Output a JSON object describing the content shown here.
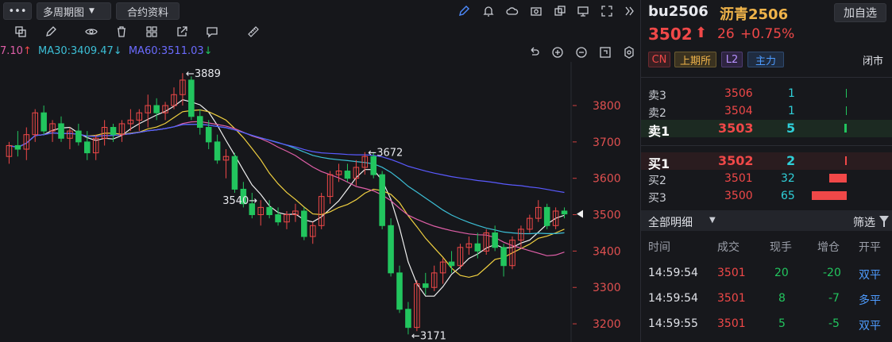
{
  "toolbar": {
    "menu_label": "•••",
    "period_label": "多周期图",
    "contract_label": "合约资料"
  },
  "legend": {
    "ma_partial": "7.10",
    "ma30": "MA30:3409.47",
    "ma60": "MA60:3511.03"
  },
  "chart_data": {
    "type": "candlestick",
    "y_ticks": [
      "3800",
      "3700",
      "3600",
      "3500",
      "3400",
      "3300",
      "3200"
    ],
    "ylim": [
      3150,
      3920
    ],
    "current_price": "3502",
    "annotations": [
      {
        "label": "←3889",
        "value": 3889
      },
      {
        "label": "←3672",
        "value": 3672
      },
      {
        "label": "3540→",
        "value": 3540
      },
      {
        "label": "←3171",
        "value": 3171
      }
    ],
    "candles": [
      [
        3660,
        3700,
        3640,
        3690
      ],
      [
        3690,
        3730,
        3660,
        3680
      ],
      [
        3680,
        3740,
        3650,
        3720
      ],
      [
        3720,
        3790,
        3700,
        3780
      ],
      [
        3780,
        3800,
        3720,
        3730
      ],
      [
        3730,
        3760,
        3700,
        3750
      ],
      [
        3750,
        3770,
        3700,
        3710
      ],
      [
        3710,
        3740,
        3680,
        3730
      ],
      [
        3730,
        3750,
        3690,
        3700
      ],
      [
        3700,
        3730,
        3650,
        3670
      ],
      [
        3670,
        3720,
        3650,
        3710
      ],
      [
        3710,
        3760,
        3690,
        3740
      ],
      [
        3740,
        3750,
        3700,
        3720
      ],
      [
        3720,
        3760,
        3700,
        3750
      ],
      [
        3750,
        3790,
        3730,
        3760
      ],
      [
        3760,
        3790,
        3730,
        3780
      ],
      [
        3780,
        3830,
        3740,
        3800
      ],
      [
        3800,
        3820,
        3760,
        3780
      ],
      [
        3780,
        3810,
        3760,
        3800
      ],
      [
        3800,
        3850,
        3790,
        3830
      ],
      [
        3830,
        3889,
        3800,
        3870
      ],
      [
        3870,
        3880,
        3760,
        3770
      ],
      [
        3770,
        3790,
        3720,
        3740
      ],
      [
        3740,
        3760,
        3680,
        3700
      ],
      [
        3700,
        3720,
        3640,
        3650
      ],
      [
        3650,
        3680,
        3600,
        3660
      ],
      [
        3660,
        3670,
        3560,
        3570
      ],
      [
        3570,
        3590,
        3520,
        3530
      ],
      [
        3530,
        3560,
        3490,
        3500
      ],
      [
        3500,
        3540,
        3470,
        3520
      ],
      [
        3520,
        3540,
        3490,
        3500
      ],
      [
        3500,
        3520,
        3470,
        3480
      ],
      [
        3480,
        3510,
        3460,
        3500
      ],
      [
        3500,
        3530,
        3480,
        3510
      ],
      [
        3510,
        3520,
        3430,
        3440
      ],
      [
        3440,
        3480,
        3420,
        3470
      ],
      [
        3470,
        3560,
        3460,
        3550
      ],
      [
        3550,
        3620,
        3530,
        3610
      ],
      [
        3610,
        3640,
        3590,
        3620
      ],
      [
        3620,
        3640,
        3590,
        3600
      ],
      [
        3600,
        3650,
        3580,
        3630
      ],
      [
        3630,
        3672,
        3610,
        3660
      ],
      [
        3660,
        3672,
        3600,
        3610
      ],
      [
        3610,
        3620,
        3460,
        3470
      ],
      [
        3470,
        3490,
        3330,
        3340
      ],
      [
        3340,
        3360,
        3230,
        3240
      ],
      [
        3240,
        3260,
        3171,
        3190
      ],
      [
        3190,
        3320,
        3180,
        3310
      ],
      [
        3310,
        3340,
        3280,
        3300
      ],
      [
        3300,
        3360,
        3290,
        3340
      ],
      [
        3340,
        3380,
        3310,
        3370
      ],
      [
        3370,
        3400,
        3340,
        3360
      ],
      [
        3360,
        3420,
        3350,
        3410
      ],
      [
        3410,
        3440,
        3390,
        3420
      ],
      [
        3420,
        3450,
        3380,
        3400
      ],
      [
        3400,
        3460,
        3390,
        3450
      ],
      [
        3450,
        3470,
        3400,
        3410
      ],
      [
        3410,
        3420,
        3330,
        3360
      ],
      [
        3360,
        3440,
        3350,
        3430
      ],
      [
        3430,
        3470,
        3410,
        3460
      ],
      [
        3460,
        3500,
        3450,
        3490
      ],
      [
        3490,
        3540,
        3480,
        3520
      ],
      [
        3520,
        3530,
        3460,
        3470
      ],
      [
        3470,
        3520,
        3460,
        3510
      ],
      [
        3510,
        3520,
        3490,
        3502
      ]
    ]
  },
  "quote": {
    "code": "bu2506",
    "name": "沥青2506",
    "add_label": "加自选",
    "price": "3502",
    "change": "26",
    "change_pct": "+0.75%",
    "tags": [
      "CN",
      "上期所",
      "L2",
      "主力"
    ],
    "status": "闭市"
  },
  "orderbook": {
    "asks": [
      {
        "label": "卖3",
        "price": "3506",
        "vol": "1"
      },
      {
        "label": "卖2",
        "price": "3504",
        "vol": "1"
      },
      {
        "label": "卖1",
        "price": "3503",
        "vol": "5"
      }
    ],
    "bids": [
      {
        "label": "买1",
        "price": "3502",
        "vol": "2"
      },
      {
        "label": "买2",
        "price": "3501",
        "vol": "32"
      },
      {
        "label": "买3",
        "price": "3500",
        "vol": "65"
      }
    ]
  },
  "ticks": {
    "filter_label": "全部明细",
    "screen_label": "筛选",
    "headers": [
      "时间",
      "成交",
      "现手",
      "增仓",
      "开平"
    ],
    "rows": [
      [
        "14:59:54",
        "3501",
        "20",
        "-20",
        "双平"
      ],
      [
        "14:59:54",
        "3501",
        "8",
        "-7",
        "多平"
      ],
      [
        "14:59:55",
        "3501",
        "5",
        "-5",
        "双平"
      ]
    ]
  }
}
